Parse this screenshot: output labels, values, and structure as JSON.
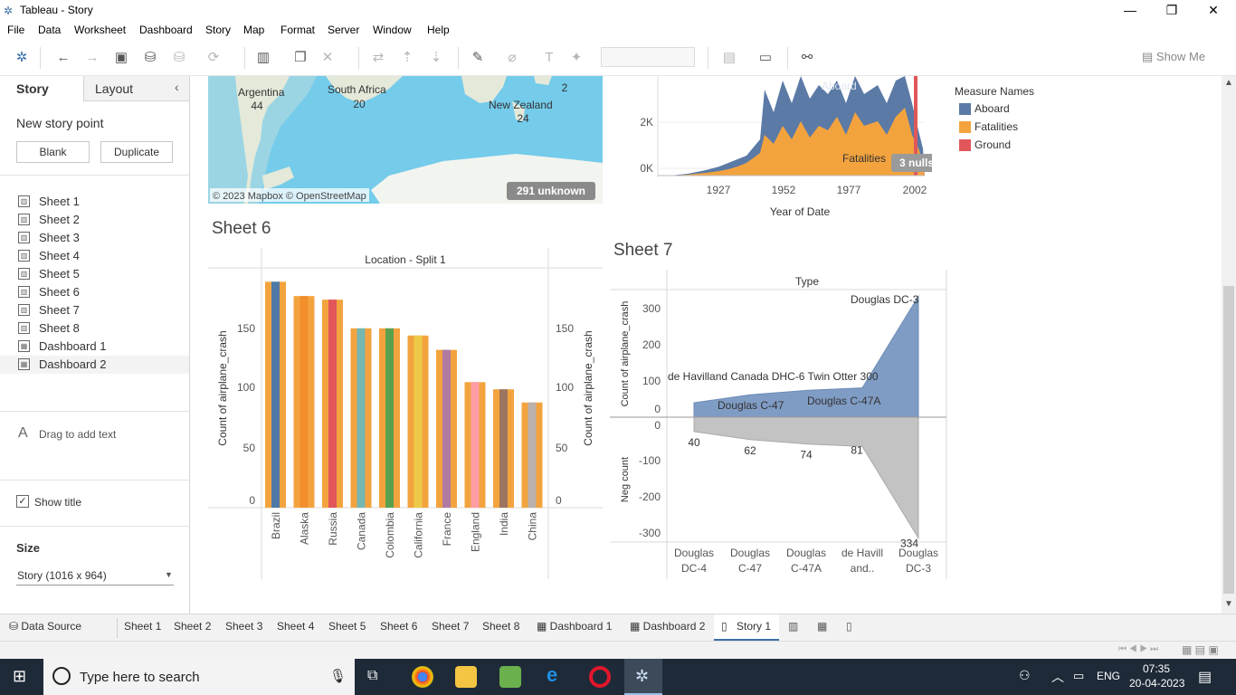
{
  "window": {
    "title": "Tableau - Story"
  },
  "menu": [
    "File",
    "Data",
    "Worksheet",
    "Dashboard",
    "Story",
    "Map",
    "Format",
    "Server",
    "Window",
    "Help"
  ],
  "toolbar": {
    "show_me": "Show Me"
  },
  "left_panel": {
    "tabs": [
      "Story",
      "Layout"
    ],
    "new_story_point": "New story point",
    "blank_button": "Blank",
    "duplicate_button": "Duplicate",
    "sheets": [
      "Sheet 1",
      "Sheet 2",
      "Sheet 3",
      "Sheet 4",
      "Sheet 5",
      "Sheet 6",
      "Sheet 7",
      "Sheet 8",
      "Dashboard 1",
      "Dashboard 2"
    ],
    "drag_text": "Drag to add text",
    "show_title": "Show title",
    "size_label": "Size",
    "size_value": "Story (1016 x 964)"
  },
  "map": {
    "labels": [
      {
        "name": "Argentina",
        "value": "44"
      },
      {
        "name": "South Africa",
        "value": "20"
      },
      {
        "name": "New Zealand",
        "value": "24"
      },
      {
        "name": "",
        "value": "2"
      }
    ],
    "attribution": "© 2023 Mapbox © OpenStreetMap",
    "unknown_badge": "291 unknown"
  },
  "sheet5_area": {
    "y_ticks": [
      "2K",
      "0K"
    ],
    "x_ticks": [
      "1927",
      "1952",
      "1977",
      "2002"
    ],
    "x_title": "Year of Date",
    "labels": [
      "Aboard",
      "Fatalities"
    ],
    "nulls_badge": "3 nulls",
    "legend_title": "Measure Names",
    "legend": [
      {
        "name": "Aboard",
        "color": "#5b7aa6"
      },
      {
        "name": "Fatalities",
        "color": "#f3a33e"
      },
      {
        "name": "Ground",
        "color": "#e15759"
      }
    ]
  },
  "sheet6": {
    "title": "Sheet 6",
    "header": "Location - Split 1",
    "y_label": "Count of airplane_crash",
    "y_ticks": [
      "0",
      "50",
      "100",
      "150"
    ]
  },
  "sheet7": {
    "title": "Sheet 7",
    "header": "Type",
    "y_label_top": "Count of airplane_crash",
    "y_label_bottom": "Neg count",
    "y_ticks_top": [
      "0",
      "100",
      "200",
      "300"
    ],
    "y_ticks_bottom": [
      "0",
      "-100",
      "-200",
      "-300"
    ],
    "area_labels": [
      "Douglas DC-3",
      "de Havilland Canada DHC-6 Twin Otter 300",
      "Douglas C-47A",
      "Douglas C-47"
    ],
    "categories": [
      [
        "Douglas",
        "DC-4"
      ],
      [
        "Douglas",
        "C-47"
      ],
      [
        "Douglas",
        "C-47A"
      ],
      [
        "de Havill",
        "and.."
      ],
      [
        "Douglas",
        "DC-3"
      ]
    ]
  },
  "chart_data": [
    {
      "type": "bar",
      "title": "Sheet 6",
      "xlabel": "Location - Split 1",
      "ylabel": "Count of airplane_crash",
      "categories": [
        "Brazil",
        "Alaska",
        "Russia",
        "Canada",
        "Colombia",
        "California",
        "France",
        "England",
        "India",
        "China"
      ],
      "values": [
        189,
        177,
        174,
        150,
        150,
        144,
        132,
        105,
        99,
        88
      ],
      "colors": [
        "#4e79a7",
        "#f28e2b",
        "#e15759",
        "#76b7b2",
        "#59a14f",
        "#edc948",
        "#b07aa1",
        "#ff9da7",
        "#9c755f",
        "#bab0ac"
      ],
      "ylim": [
        0,
        190
      ]
    },
    {
      "type": "area",
      "title": "Sheet 7",
      "xlabel": "Type",
      "categories": [
        "Douglas DC-4",
        "Douglas C-47",
        "Douglas C-47A",
        "de Havilland Canada DHC-6 Twin Otter 300",
        "Douglas DC-3"
      ],
      "series": [
        {
          "name": "Count of airplane_crash",
          "values": [
            40,
            62,
            74,
            81,
            334
          ]
        },
        {
          "name": "Neg count",
          "values": [
            -40,
            -62,
            -74,
            -81,
            -334
          ]
        }
      ],
      "data_labels": [
        "40",
        "62",
        "74",
        "81",
        "334"
      ],
      "ylim": [
        -350,
        350
      ]
    },
    {
      "type": "area",
      "xlabel": "Year of Date",
      "series": [
        {
          "name": "Aboard"
        },
        {
          "name": "Fatalities"
        },
        {
          "name": "Ground"
        }
      ],
      "x_ticks": [
        "1927",
        "1952",
        "1977",
        "2002"
      ],
      "y_ticks": [
        "0K",
        "2K"
      ]
    }
  ],
  "bottom_tabs": [
    "Data Source",
    "Sheet 1",
    "Sheet 2",
    "Sheet 3",
    "Sheet 4",
    "Sheet 5",
    "Sheet 6",
    "Sheet 7",
    "Sheet 8",
    "Dashboard 1",
    "Dashboard 2",
    "Story 1"
  ],
  "taskbar": {
    "search_placeholder": "Type here to search",
    "lang": "ENG",
    "time": "07:35",
    "date": "20-04-2023"
  }
}
